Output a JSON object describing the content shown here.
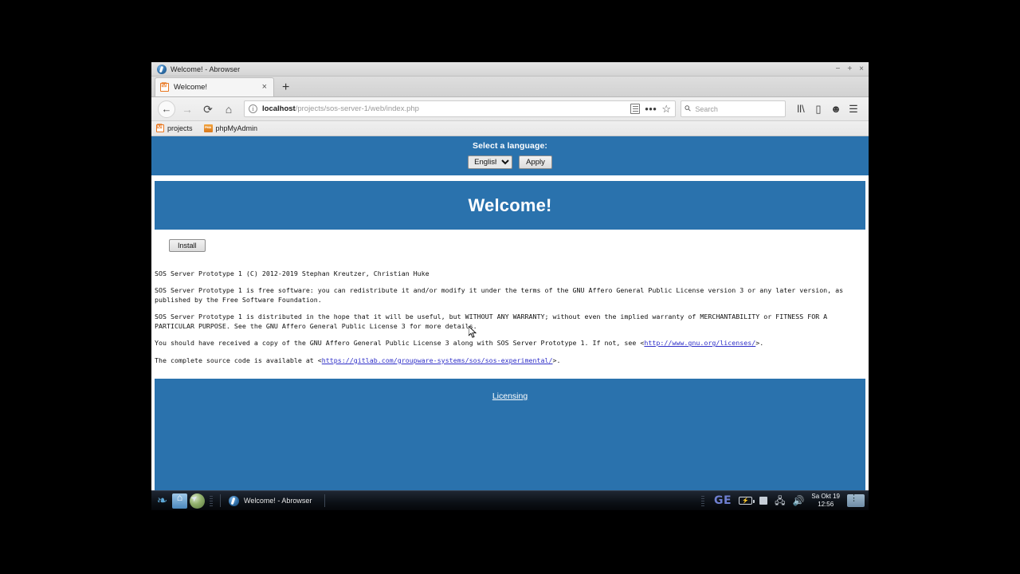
{
  "window": {
    "title": "Welcome! - Abrowser",
    "controls": {
      "minimize": "−",
      "maximize": "+",
      "close": "×"
    }
  },
  "tabs": [
    {
      "label": "Welcome!",
      "favicon": "broken-image-icon",
      "close_label": "×"
    }
  ],
  "newtab_label": "+",
  "navigation": {
    "back_label": "←",
    "forward_label": "→",
    "reload_label": "⟳",
    "home_label": "⌂"
  },
  "urlbar": {
    "info_icon": "info-icon",
    "host": "localhost",
    "path": "/projects/sos-server-1/web/index.php",
    "reader_icon": "reader-view-icon",
    "more_icon": "page-actions-icon",
    "bookmark_icon": "star-icon"
  },
  "search": {
    "placeholder": "Search",
    "icon": "search-icon"
  },
  "toolbar_icons": {
    "library": "library-icon",
    "sidebar": "sidebar-icon",
    "account": "account-icon",
    "menu": "hamburger-menu-icon"
  },
  "bookmarks": [
    {
      "label": "projects",
      "icon": "broken-image-icon"
    },
    {
      "label": "phpMyAdmin",
      "icon": "phpmyadmin-icon"
    }
  ],
  "page": {
    "language_bar": {
      "label": "Select a language:",
      "selected": "English",
      "options": [
        "English"
      ],
      "apply_label": "Apply"
    },
    "hero_title": "Welcome!",
    "install_label": "Install",
    "license": {
      "copyright": "SOS Server Prototype 1 (C) 2012-2019 Stephan Kreutzer, Christian Huke",
      "paragraph_free_software": "SOS Server Prototype 1 is free software: you can redistribute it and/or modify it under the terms of the GNU Affero General Public License version 3 or any later version, as published by the Free Software Foundation.",
      "paragraph_warranty": "SOS Server Prototype 1 is distributed in the hope that it will be useful, but WITHOUT ANY WARRANTY; without even the implied warranty of MERCHANTABILITY or FITNESS FOR A PARTICULAR PURPOSE. See the GNU Affero General Public License 3 for more details.",
      "paragraph_copy_prefix": "You should have received a copy of the GNU Affero General Public License 3 along with SOS Server Prototype 1. If not, see <",
      "gnu_link": "http://www.gnu.org/licenses/",
      "paragraph_copy_suffix": ">.",
      "paragraph_source_prefix": "The complete source code is available at <",
      "source_link": "https://gitlab.com/groupware-systems/sos/sos-experimental/",
      "paragraph_source_suffix": ">."
    },
    "footer_link": "Licensing",
    "accent_color": "#2a72ad"
  },
  "taskbar": {
    "launchers": [
      {
        "name": "swirl-icon",
        "glyph": "❧"
      },
      {
        "name": "file-manager-icon",
        "glyph": ""
      },
      {
        "name": "browser-icon",
        "glyph": ""
      }
    ],
    "task_items": [
      {
        "label": "Welcome! - Abrowser",
        "icon": "abrowser-icon"
      }
    ],
    "tray": {
      "keyboard_layout": "GE",
      "battery_icon": "battery-icon",
      "display_icon": "display-icon",
      "network_icon": "network-icon",
      "volume_icon": "volume-icon",
      "clock_date": "Sa Okt 19",
      "clock_time": "12:56",
      "app_icon": "tray-app-icon"
    }
  }
}
